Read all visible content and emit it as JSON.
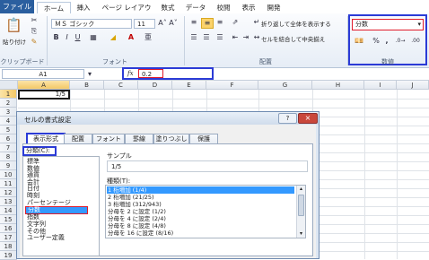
{
  "ribbon_tabs": [
    "ファイル",
    "ホーム",
    "挿入",
    "ページ レイアウト",
    "数式",
    "データ",
    "校閲",
    "表示",
    "開発"
  ],
  "clipboard": {
    "paste": "貼り付け",
    "group": "クリップボード"
  },
  "font": {
    "name": "ＭＳ ゴシック",
    "size": "11",
    "bold": "B",
    "italic": "I",
    "underline": "U",
    "group": "フォント"
  },
  "alignment": {
    "wrap": "折り返して全体を表示する",
    "merge": "セルを結合して中央揃え",
    "group": "配置"
  },
  "number": {
    "format": "分数",
    "percent": "%",
    "comma": ",",
    "group": "数値"
  },
  "namebox": "A1",
  "fx": "fx",
  "formula": "0.2",
  "columns": [
    "A",
    "B",
    "C",
    "D",
    "E",
    "F",
    "G",
    "H",
    "I",
    "J"
  ],
  "rows": [
    "1",
    "2",
    "3",
    "4",
    "5",
    "6",
    "7",
    "8",
    "9",
    "10",
    "11",
    "12",
    "13",
    "14",
    "15",
    "16",
    "17",
    "18",
    "19"
  ],
  "cell_a1": "1/5",
  "dialog": {
    "title": "セルの書式設定",
    "help": "?",
    "close": "×",
    "tabs": [
      "表示形式",
      "配置",
      "フォント",
      "罫線",
      "塗りつぶし",
      "保護"
    ],
    "category_label": "分類(C):",
    "categories": [
      "標準",
      "数値",
      "通貨",
      "会計",
      "日付",
      "時刻",
      "パーセンテージ",
      "分数",
      "指数",
      "文字列",
      "その他",
      "ユーザー定義"
    ],
    "sample_label": "サンプル",
    "sample_value": "1/5",
    "type_label": "種類(T):",
    "types": [
      "1 桁増加 (1/4)",
      "2 桁増加 (21/25)",
      "3 桁増加 (312/943)",
      "分母を 2 に設定 (1/2)",
      "分母を 4 に設定 (2/4)",
      "分母を 8 に設定 (4/8)",
      "分母を 16 に設定 (8/16)"
    ]
  }
}
